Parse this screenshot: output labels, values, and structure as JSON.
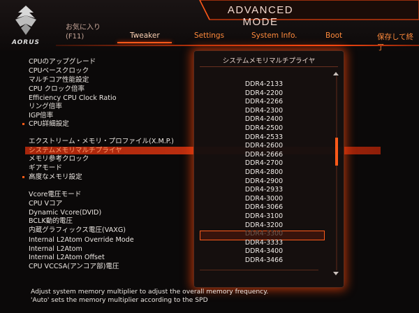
{
  "header": {
    "logo_text": "AORUS",
    "mode_title": "ADVANCED MODE",
    "favorites_label": "お気に入り",
    "favorites_key": "(F11)",
    "save_exit": "保存して終了"
  },
  "tabs": [
    {
      "label": "Tweaker",
      "active": true
    },
    {
      "label": "Settings",
      "active": false
    },
    {
      "label": "System Info.",
      "active": false
    },
    {
      "label": "Boot",
      "active": false
    }
  ],
  "menu": [
    {
      "label": "CPUのアップグレード",
      "bullet": false
    },
    {
      "label": "CPUベースクロック",
      "bullet": false
    },
    {
      "label": "マルチコア性能設定",
      "bullet": false
    },
    {
      "label": "CPU クロック倍率",
      "bullet": false
    },
    {
      "label": "Efficiency CPU Clock Ratio",
      "bullet": false
    },
    {
      "label": "リング倍率",
      "bullet": false
    },
    {
      "label": "IGP倍率",
      "bullet": false
    },
    {
      "label": "CPU詳細設定",
      "bullet": true
    },
    {
      "label": "エクストリーム・メモリ・プロファイル(X.M.P.)",
      "bullet": false
    },
    {
      "label": "システムメモリマルチプライヤ",
      "bullet": false,
      "selected": true
    },
    {
      "label": "メモリ参考クロック",
      "bullet": false
    },
    {
      "label": "ギアモード",
      "bullet": false
    },
    {
      "label": "高度なメモリ設定",
      "bullet": true
    },
    {
      "label": "Vcore電圧モード",
      "bullet": false
    },
    {
      "label": "CPU Vコア",
      "bullet": false
    },
    {
      "label": "Dynamic Vcore(DVID)",
      "bullet": false
    },
    {
      "label": "BCLK動的電圧",
      "bullet": false
    },
    {
      "label": "内蔵グラフィックス電圧(VAXG)",
      "bullet": false
    },
    {
      "label": "Internal L2Atom Override Mode",
      "bullet": false
    },
    {
      "label": "Internal L2Atom",
      "bullet": false
    },
    {
      "label": "Internal L2Atom Offset",
      "bullet": false
    },
    {
      "label": "CPU VCCSA(アンコア部)電圧",
      "bullet": false
    }
  ],
  "popup": {
    "title": "システムメモリマルチプライヤ",
    "selected_index": 16,
    "options": [
      "DDR4-2133",
      "DDR4-2200",
      "DDR4-2266",
      "DDR4-2300",
      "DDR4-2400",
      "DDR4-2500",
      "DDR4-2533",
      "DDR4-2600",
      "DDR4-2666",
      "DDR4-2700",
      "DDR4-2800",
      "DDR4-2900",
      "DDR4-2933",
      "DDR4-3000",
      "DDR4-3066",
      "DDR4-3100",
      "DDR4-3200",
      "DDR4-3300",
      "DDR4-3333",
      "DDR4-3400",
      "DDR4-3466"
    ]
  },
  "help": {
    "line1": "Adjust system memory multiplier to adjust the overall memory frequency.",
    "line2": "'Auto' sets the memory multiplier according to the SPD"
  },
  "colors": {
    "accent": "#ff5a1a",
    "highlight": "#b8300f",
    "background": "#0b0909"
  }
}
